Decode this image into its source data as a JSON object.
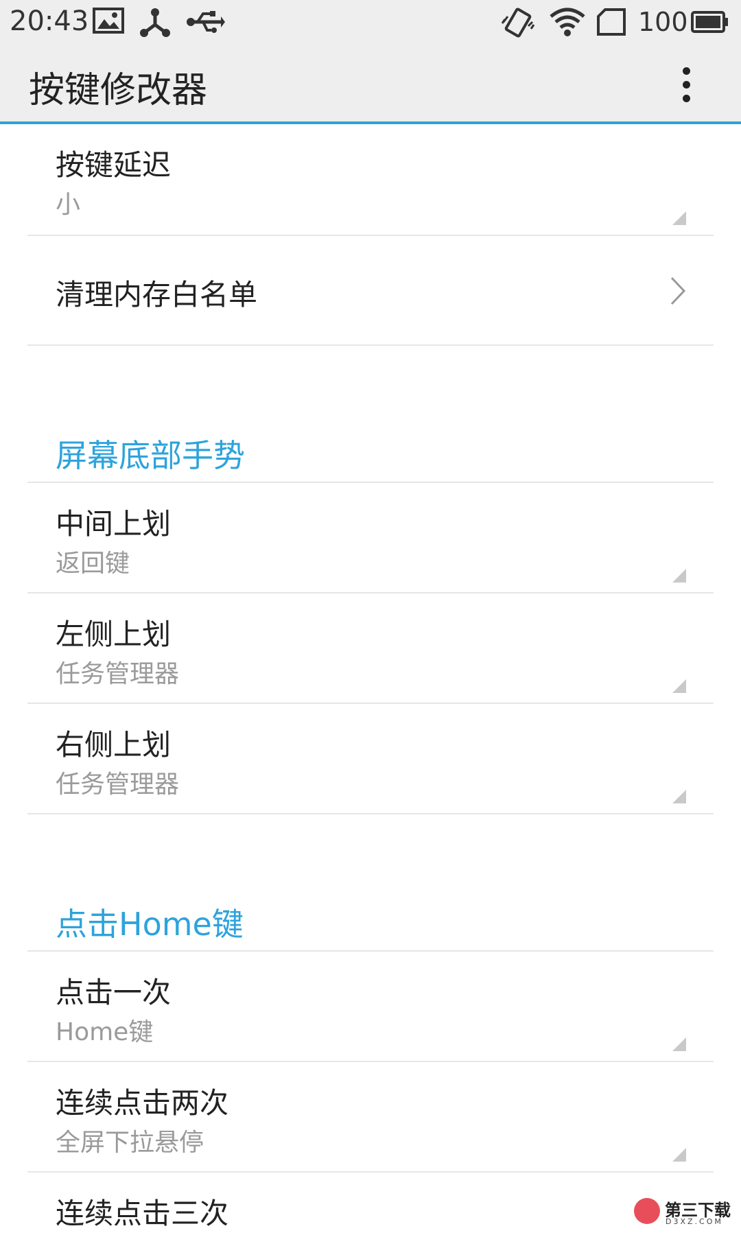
{
  "status_bar": {
    "time": "20:43",
    "battery_level": "100",
    "icons": [
      "gallery-icon",
      "usb-tether-icon",
      "usb-icon",
      "vibrate-icon",
      "wifi-icon",
      "sim-icon",
      "battery-icon"
    ]
  },
  "app_bar": {
    "title": "按键修改器",
    "menu_icon": "more-vert-icon"
  },
  "colors": {
    "accent": "#2ea3dc",
    "bar_background": "#eeeeee",
    "summary_text": "#9a9a9a"
  },
  "items": {
    "key_delay": {
      "title": "按键延迟",
      "summary": "小"
    },
    "memory_whitelist": {
      "title": "清理内存白名单"
    }
  },
  "sections": {
    "bottom_gesture": {
      "label": "屏幕底部手势",
      "items": [
        {
          "title": "中间上划",
          "summary": "返回键"
        },
        {
          "title": "左侧上划",
          "summary": "任务管理器"
        },
        {
          "title": "右侧上划",
          "summary": "任务管理器"
        }
      ]
    },
    "home_click": {
      "label": "点击Home键",
      "items": [
        {
          "title": "点击一次",
          "summary": "Home键"
        },
        {
          "title": "连续点击两次",
          "summary": "全屏下拉悬停"
        },
        {
          "title": "连续点击三次"
        }
      ]
    }
  },
  "watermark": {
    "text": "第三下载",
    "sub": "D3XZ.COM"
  }
}
